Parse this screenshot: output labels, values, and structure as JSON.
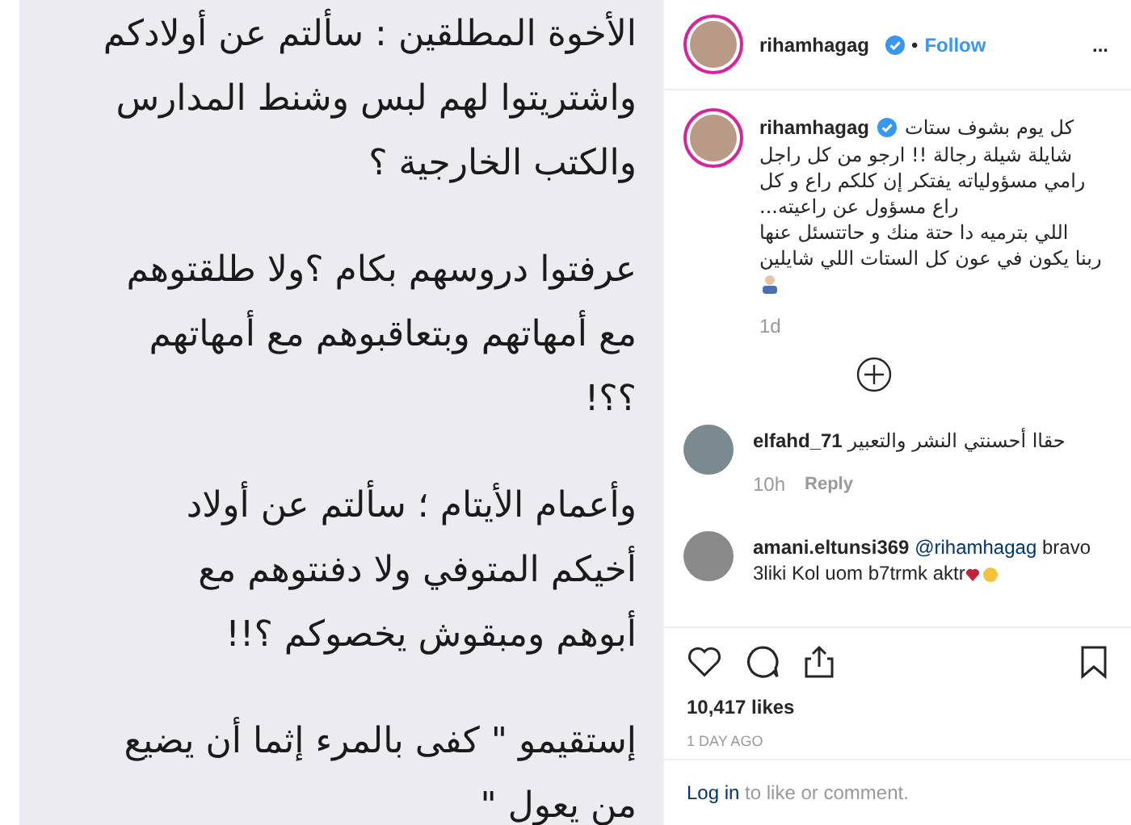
{
  "post_image": {
    "paragraphs": [
      {
        "lines": [
          "الأخوة المطلقين : سألتم عن أولادكم",
          "واشتريتوا لهم لبس وشنط المدارس",
          "والكتب الخارجية ؟"
        ]
      },
      {
        "lines": [
          "عرفتوا دروسهم بكام ؟ولا طلقتوهم",
          "مع أمهاتهم وبتعاقبوهم مع أمهاتهم",
          "؟؟!"
        ]
      },
      {
        "lines": [
          "وأعمام الأيتام ؛ سألتم عن أولاد",
          "أخيكم المتوفي ولا دفنتوهم مع",
          "أبوهم ومبقوش يخصوكم ؟!!"
        ]
      },
      {
        "lines": [
          "إستقيمو \" كفى بالمرء إثما أن يضيع",
          "من يعول \""
        ]
      }
    ]
  },
  "header": {
    "username": "rihamhagag",
    "verified": true,
    "separator": "•",
    "follow": "Follow",
    "more": "..."
  },
  "caption": {
    "username": "rihamhagag",
    "verified": true,
    "first_line": "كل يوم بشوف ستات",
    "lines": [
      "شايلة شيلة رجالة !! ارجو من كل راجل",
      "رامي مسؤولياته يفتكر إن كلكم راع و كل",
      "راع مسؤول عن راعيته...",
      "اللي بترميه دا حتة منك و حاتتسئل عنها",
      "ربنا يكون في عون كل الستات اللي شايلين"
    ],
    "time": "1d"
  },
  "comments": [
    {
      "username": "elfahd_71",
      "text": "حقاا أحسنتي النشر والتعبير",
      "time": "10h",
      "reply": "Reply"
    },
    {
      "username": "amani.eltunsi369",
      "mention": "@rihamhagag",
      "text": "bravo 3liki Kol uom b7trmk aktr"
    }
  ],
  "likes": "10,417 likes",
  "date": "1 DAY AGO",
  "login": {
    "link": "Log in",
    "rest": "to like or comment."
  }
}
